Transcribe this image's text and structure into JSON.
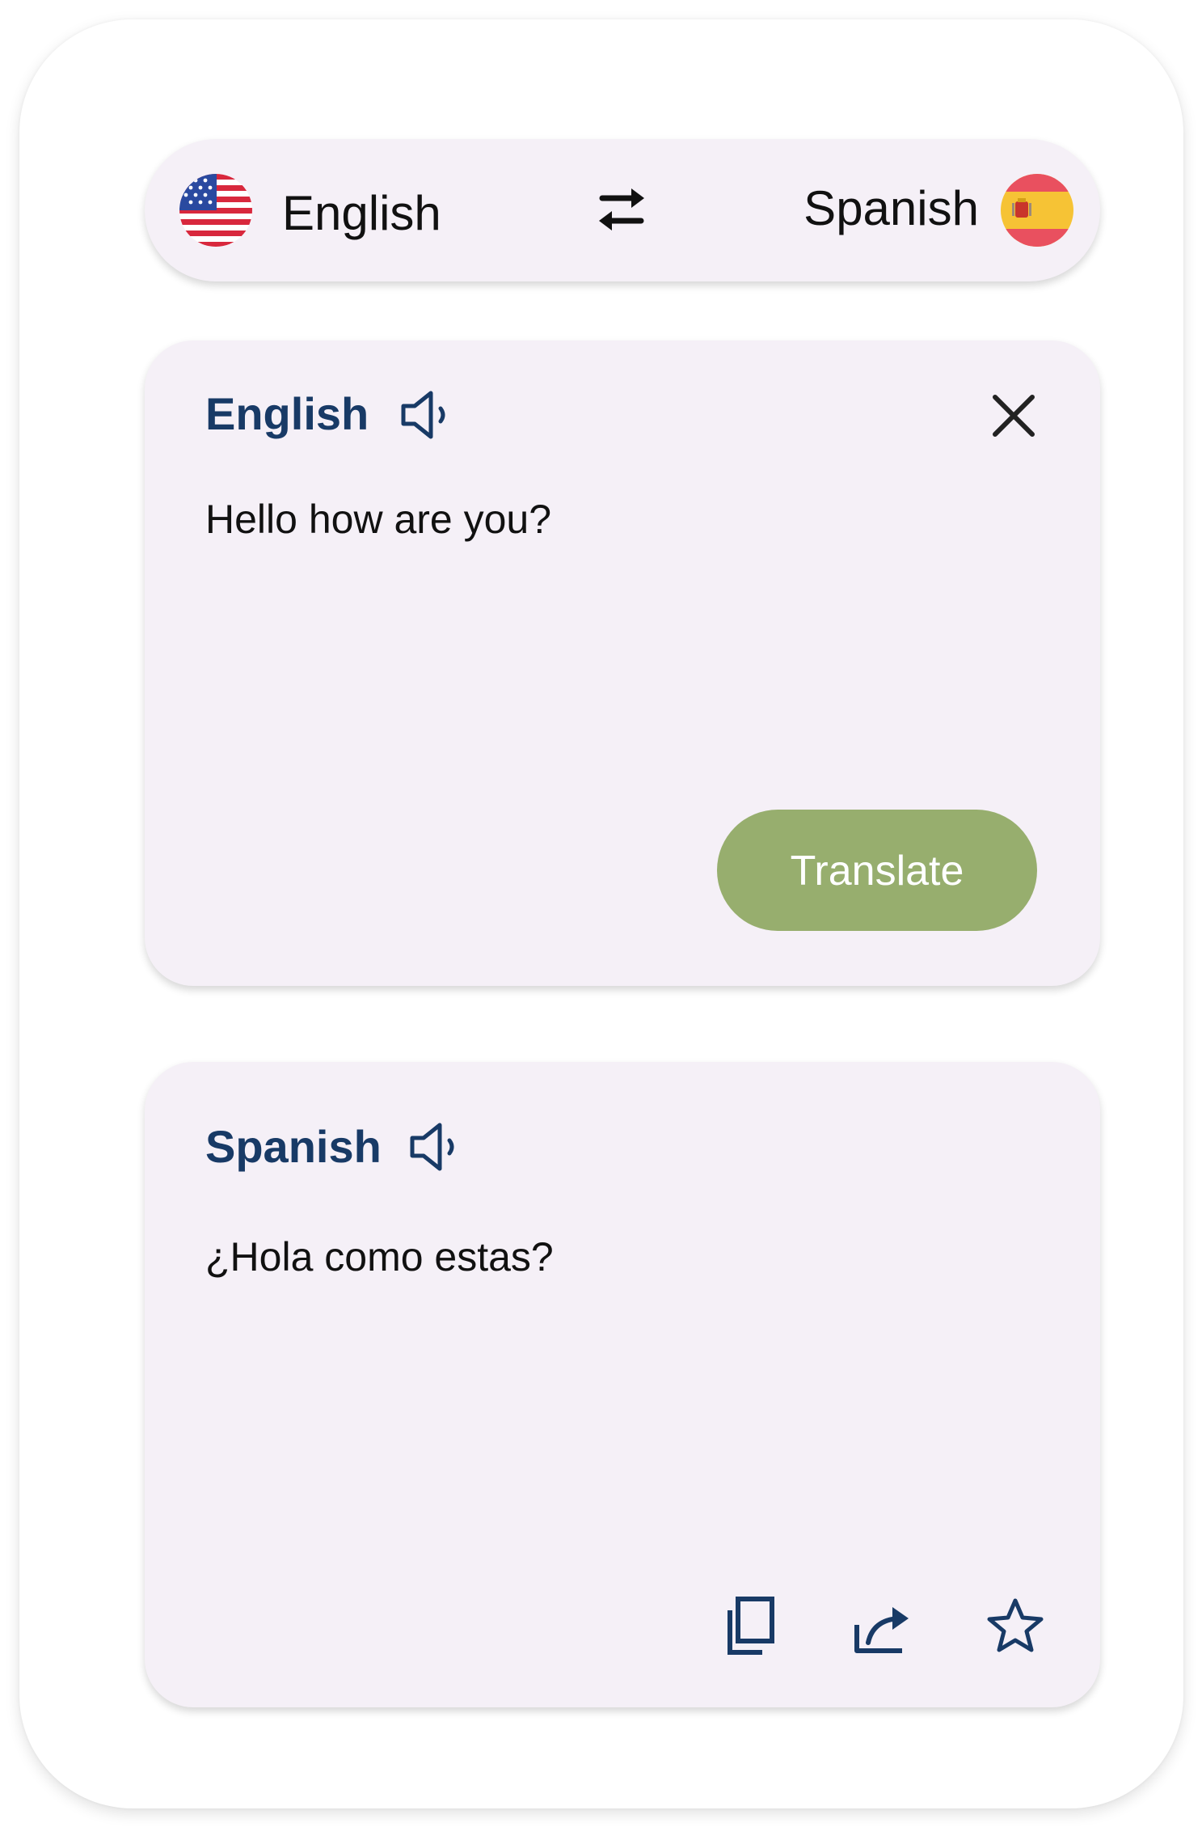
{
  "language_bar": {
    "source_language": "English",
    "target_language": "Spanish",
    "source_flag_icon": "us-flag-icon",
    "target_flag_icon": "spain-flag-icon",
    "swap_icon": "swap-arrows-icon"
  },
  "source_card": {
    "title": "English",
    "input_text": "Hello how are you?",
    "speaker_icon": "speaker-icon",
    "clear_icon": "close-icon",
    "translate_label": "Translate"
  },
  "target_card": {
    "title": "Spanish",
    "output_text": "¿Hola como estas?",
    "speaker_icon": "speaker-icon",
    "actions": [
      "copy-icon",
      "share-icon",
      "star-icon"
    ]
  },
  "colors": {
    "card_background": "#f5f0f7",
    "title_color": "#183a66",
    "translate_button": "#97ae6e",
    "icon_color": "#183a66"
  }
}
